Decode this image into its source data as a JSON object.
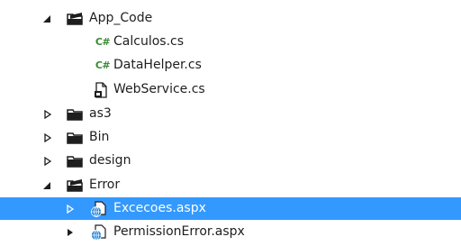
{
  "tree": {
    "items": [
      {
        "label": "App_Code",
        "icon": "folder-open-icon",
        "state": "expanded"
      },
      {
        "label": "Calculos.cs",
        "icon": "csharp-file-icon",
        "icon_text": "C#"
      },
      {
        "label": "DataHelper.cs",
        "icon": "csharp-file-icon",
        "icon_text": "C#"
      },
      {
        "label": "WebService.cs",
        "icon": "webservice-file-icon"
      },
      {
        "label": "as3",
        "icon": "folder-icon",
        "state": "collapsed"
      },
      {
        "label": "Bin",
        "icon": "folder-icon",
        "state": "collapsed"
      },
      {
        "label": "design",
        "icon": "folder-icon",
        "state": "collapsed"
      },
      {
        "label": "Error",
        "icon": "folder-open-icon",
        "state": "expanded"
      },
      {
        "label": "Excecoes.aspx",
        "icon": "aspx-file-icon",
        "state": "collapsed",
        "selected": true
      },
      {
        "label": "PermissionError.aspx",
        "icon": "aspx-file-icon",
        "state": "collapsed"
      }
    ]
  },
  "colors": {
    "selection": "#3399ff",
    "text": "#1e1e1e",
    "csharp": "#388a34"
  }
}
